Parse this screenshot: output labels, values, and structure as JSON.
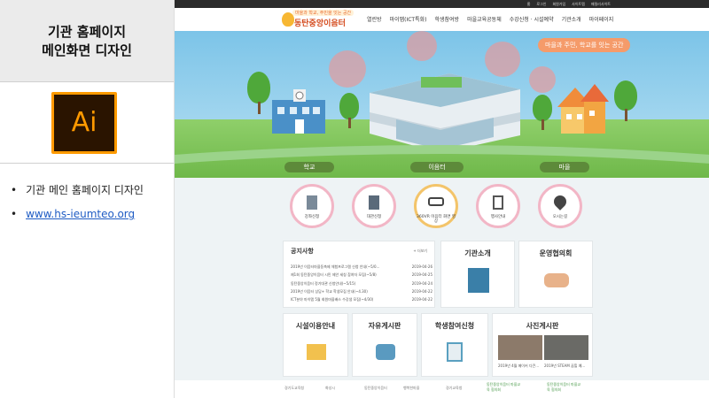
{
  "slide": {
    "title_line1": "기관 홈페이지",
    "title_line2": "메인화면 디자인",
    "app_icon": {
      "name": "illustrator-icon",
      "text": "Ai",
      "border_color": "#ff9a00",
      "bg_color": "#2a1400"
    },
    "bullets": [
      "기관 메인 홈페이지 디자인"
    ],
    "link": "www.hs-ieumteo.org"
  },
  "site": {
    "topbar": [
      "홈",
      "로그인",
      "회원가입",
      "사이트맵",
      "패밀리사이트"
    ],
    "logo": {
      "subtitle": "마을과 학교, 주민을 잇는 공간",
      "name": "동탄중앙이음터"
    },
    "nav": [
      "열린방",
      "마이맵(ICT특화)",
      "학생참여방",
      "마을교육공동체",
      "수강신청 · 시설예약",
      "기관소개",
      "마이페이지"
    ],
    "hero": {
      "slogan": "마을과 주민, 학교를 잇는 공간",
      "labels": [
        "학교",
        "이음터",
        "마을"
      ]
    },
    "quick": [
      {
        "label": "강좌신청",
        "icon": "document-icon"
      },
      {
        "label": "대관신청",
        "icon": "building-icon"
      },
      {
        "label": "360VR 이음터 화면 영상",
        "icon": "vr-icon"
      },
      {
        "label": "행사안내",
        "icon": "calendar-icon"
      },
      {
        "label": "오시는길",
        "icon": "location-icon"
      }
    ],
    "notice": {
      "title": "공지사항",
      "more": "+ 더보기",
      "items": [
        {
          "text": "2019년 이음터마을동축제 체험프로그램 신청 안내(~5/0...",
          "date": "2019-04-26"
        },
        {
          "text": "제1회 동탄중앙이음터 시민 제안 세칭 참여자 모집(~5/8)",
          "date": "2019-04-25"
        },
        {
          "text": "동탄중앙이음터 정기대관 신청안내(~5/15)",
          "date": "2019-04-24"
        },
        {
          "text": "2019년 이음터 상담+ 학교 학생모집 안내(~4.30)",
          "date": "2019-04-22"
        },
        {
          "text": "ICT분야 마이맵 5월 회원마을배스 수강생 모집(~4/30)",
          "date": "2019-04-22"
        }
      ]
    },
    "cards": {
      "about": "기관소개",
      "council": "운영협의회",
      "facility": "시설이용안내",
      "board": "자유게시판",
      "student": "학생참여신청",
      "gallery": {
        "title": "사진게시판",
        "captions": [
          "2019년 4월 메이커 다큰...",
          "2019년 STEAM 꿈힐 예..."
        ]
      }
    },
    "footer_logos": [
      "경기도교육청",
      "화성시",
      "동탄중앙이음터",
      "행복한마을",
      "경기교육청",
      "동탄중앙이음터 마을교육 협의회",
      "동탄중앙이음터 마을교육 협의회"
    ],
    "colors": {
      "accent": "#e96a2a",
      "circle_border": "#f2b6c6",
      "pill": "#5d8a3a"
    }
  }
}
